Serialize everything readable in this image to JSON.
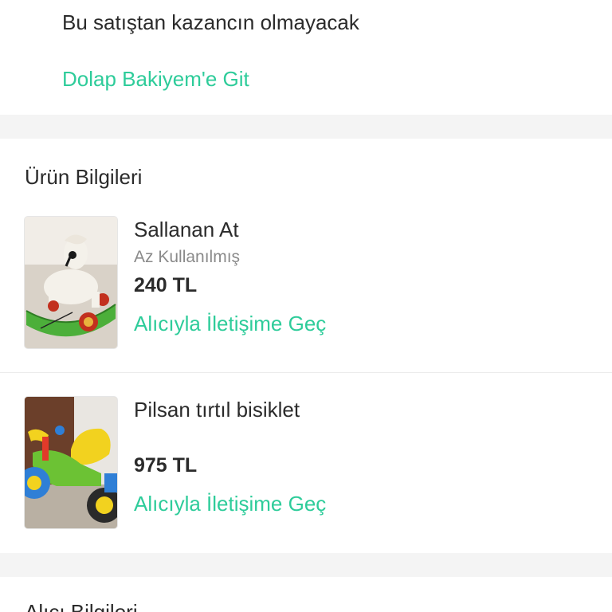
{
  "notice": {
    "text": "Bu satıştan kazancın olmayacak",
    "balance_link": "Dolap Bakiyem'e Git"
  },
  "products": {
    "title": "Ürün Bilgileri",
    "items": [
      {
        "name": "Sallanan At",
        "condition": "Az Kullanılmış",
        "price": "240 TL",
        "contact_label": "Alıcıyla İletişime Geç"
      },
      {
        "name": "Pilsan tırtıl bisiklet",
        "condition": "",
        "price": "975 TL",
        "contact_label": "Alıcıyla İletişime Geç"
      }
    ]
  },
  "buyer": {
    "title": "Alıcı Bilgileri"
  },
  "colors": {
    "accent": "#2ecc9a",
    "text": "#2b2b2b",
    "muted": "#8a8a8a",
    "band": "#f4f4f4"
  }
}
